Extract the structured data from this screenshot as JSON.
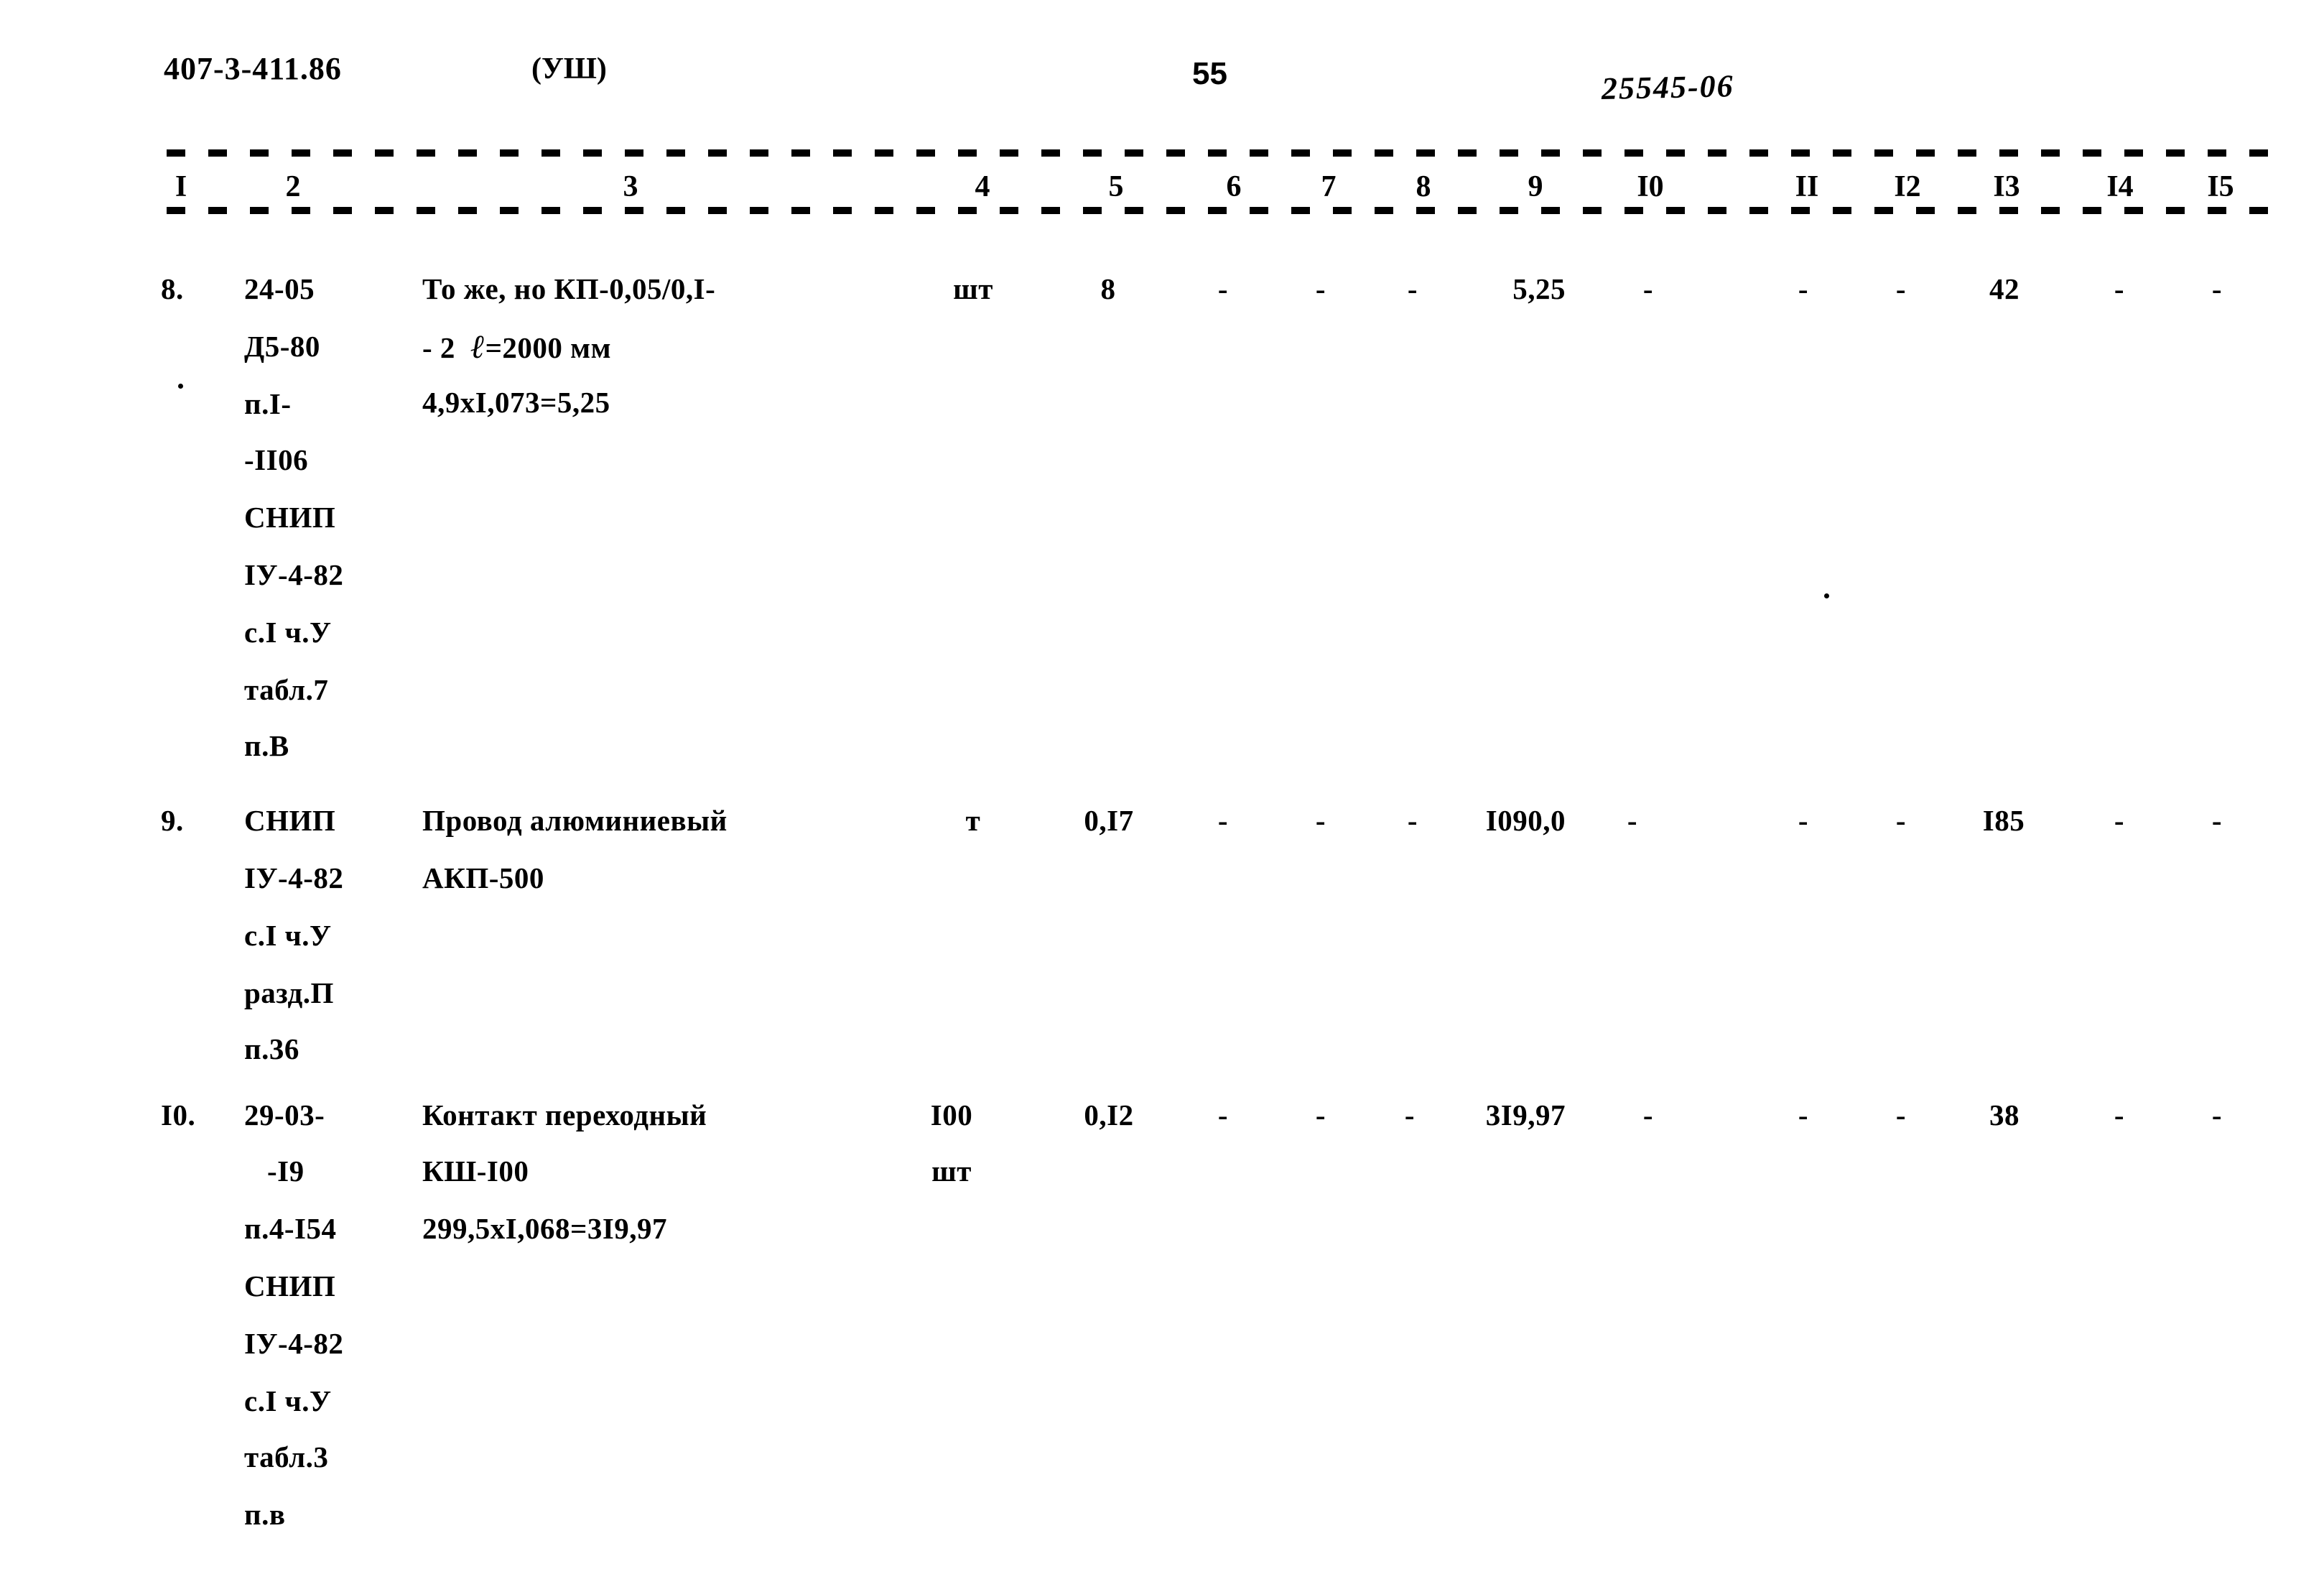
{
  "header": {
    "doc_number": "407-3-411.86",
    "part": "(УШ)",
    "page_number": "55",
    "archive_code": "25545-06"
  },
  "table": {
    "column_numbers": [
      "I",
      "2",
      "3",
      "4",
      "5",
      "6",
      "7",
      "8",
      "9",
      "I0",
      "II",
      "I2",
      "I3",
      "I4",
      "I5"
    ],
    "rows": [
      {
        "index": "8.",
        "justification_lines": [
          "24-05",
          "Д5-80",
          "п.I-",
          "-II06",
          "СНИП",
          "IУ-4-82",
          "с.I ч.У",
          "табл.7",
          "п.В"
        ],
        "description_lines": [
          "То же, но КП-0,05/0,I-",
          "- 2  ℓ=2000 мм",
          "4,9хI,073=5,25"
        ],
        "unit_lines": [
          "шт"
        ],
        "c5": "8",
        "c6": "-",
        "c7": "-",
        "c8": "-",
        "c9": "5,25",
        "c10": "-",
        "c11": "-",
        "c12": "-",
        "c13": "42",
        "c14": "-",
        "c15": "-"
      },
      {
        "index": "9.",
        "justification_lines": [
          "СНИП",
          "IУ-4-82",
          "с.I ч.У",
          "разд.П",
          "п.36"
        ],
        "description_lines": [
          "Провод алюминиевый",
          "АКП-500"
        ],
        "unit_lines": [
          "т"
        ],
        "c5": "0,I7",
        "c6": "-",
        "c7": "-",
        "c8": "-",
        "c9": "I090,0",
        "c10": "-",
        "c11": "-",
        "c12": "-",
        "c13": "I85",
        "c14": "-",
        "c15": "-"
      },
      {
        "index": "I0.",
        "justification_lines": [
          "29-03-",
          "-I9",
          "п.4-I54",
          "СНИП",
          "IУ-4-82",
          "с.I ч.У",
          "табл.3",
          "п.в"
        ],
        "description_lines": [
          "Контакт переходный",
          "КШ-I00",
          "299,5хI,068=3I9,97"
        ],
        "unit_lines": [
          "I00",
          "шт"
        ],
        "c5": "0,I2",
        "c6": "-",
        "c7": "-",
        "c8": "-",
        "c9": "3I9,97",
        "c10": "-",
        "c11": "-",
        "c12": "-",
        "c13": "38",
        "c14": "-",
        "c15": "-"
      }
    ]
  }
}
